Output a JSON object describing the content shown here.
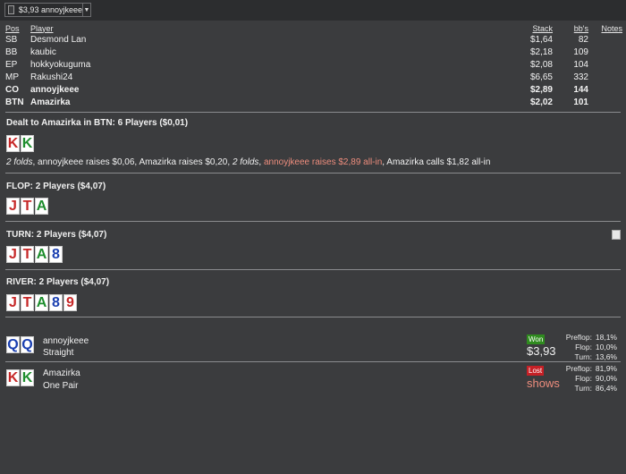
{
  "combo": {
    "label": "$3,93 annoyjkeee"
  },
  "headers": {
    "pos": "Pos",
    "player": "Player",
    "stack": "Stack",
    "bb": "bb's",
    "notes": "Notes"
  },
  "players": [
    {
      "pos": "SB",
      "name": "Desmond Lan",
      "stack": "$1,64",
      "bb": "82",
      "bold": false
    },
    {
      "pos": "BB",
      "name": "kaubic",
      "stack": "$2,18",
      "bb": "109",
      "bold": false
    },
    {
      "pos": "EP",
      "name": "hokkyokuguma",
      "stack": "$2,08",
      "bb": "104",
      "bold": false
    },
    {
      "pos": "MP",
      "name": "Rakushi24",
      "stack": "$6,65",
      "bb": "332",
      "bold": false
    },
    {
      "pos": "CO",
      "name": "annoyjkeee",
      "stack": "$2,89",
      "bb": "144",
      "bold": true
    },
    {
      "pos": "BTN",
      "name": "Amazirka",
      "stack": "$2,02",
      "bb": "101",
      "bold": true
    }
  ],
  "preflop": {
    "title": "Dealt to Amazirka in BTN: 6 Players ($0,01)",
    "cards": [
      {
        "rank": "K",
        "color": "red"
      },
      {
        "rank": "K",
        "color": "green"
      }
    ],
    "action": {
      "p1": "2 folds",
      "p2": ", annoyjkeee raises $0,06, Amazirka raises $0,20, ",
      "p3": "2 folds",
      "p4": ", ",
      "p5": "annoyjkeee raises $2,89 all-in",
      "p6": ", Amazirka calls $1,82 all-in"
    }
  },
  "flop": {
    "title": "FLOP: 2 Players ($4,07)",
    "cards": [
      {
        "rank": "J",
        "color": "red"
      },
      {
        "rank": "T",
        "color": "red"
      },
      {
        "rank": "A",
        "color": "green"
      }
    ]
  },
  "turn": {
    "title": "TURN: 2 Players ($4,07)",
    "cards": [
      {
        "rank": "J",
        "color": "red"
      },
      {
        "rank": "T",
        "color": "red"
      },
      {
        "rank": "A",
        "color": "green"
      },
      {
        "rank": "8",
        "color": "blue"
      }
    ]
  },
  "river": {
    "title": "RIVER: 2 Players ($4,07)",
    "cards": [
      {
        "rank": "J",
        "color": "red"
      },
      {
        "rank": "T",
        "color": "red"
      },
      {
        "rank": "A",
        "color": "green"
      },
      {
        "rank": "8",
        "color": "blue"
      },
      {
        "rank": "9",
        "color": "red"
      }
    ]
  },
  "results": [
    {
      "name": "annoyjkeee",
      "hand": "Straight",
      "cards": [
        {
          "rank": "Q",
          "color": "blue"
        },
        {
          "rank": "Q",
          "color": "blue"
        }
      ],
      "badge": "Won",
      "amount": "$3,93",
      "stats": [
        {
          "label": "Preflop:",
          "value": "18,1%"
        },
        {
          "label": "Flop:",
          "value": "10,0%"
        },
        {
          "label": "Turn:",
          "value": "13,6%"
        }
      ]
    },
    {
      "name": "Amazirka",
      "hand": "One Pair",
      "cards": [
        {
          "rank": "K",
          "color": "red"
        },
        {
          "rank": "K",
          "color": "green"
        }
      ],
      "badge": "Lost",
      "amount": "shows",
      "stats": [
        {
          "label": "Preflop:",
          "value": "81,9%"
        },
        {
          "label": "Flop:",
          "value": "90,0%"
        },
        {
          "label": "Turn:",
          "value": "86,4%"
        }
      ]
    }
  ],
  "icons": {
    "dropdown": "chevron-down-icon",
    "checkbox": "checkbox-icon",
    "note": "note-icon"
  }
}
